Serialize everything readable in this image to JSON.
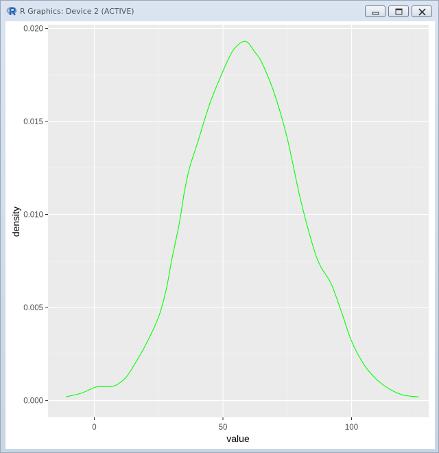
{
  "window": {
    "title": "R Graphics: Device 2 (ACTIVE)",
    "icon": "r-logo-icon",
    "buttons": [
      {
        "name": "minimize",
        "icon": "minimize-icon"
      },
      {
        "name": "maximize",
        "icon": "maximize-icon"
      },
      {
        "name": "close",
        "icon": "close-icon"
      }
    ]
  },
  "colors": {
    "panel_background": "#ebebeb",
    "grid_major": "#ffffff",
    "grid_minor": "#f5f5f5",
    "line": "#00ff00",
    "axis_text": "#4d4d4d"
  },
  "chart_data": {
    "type": "line",
    "geom": "density",
    "xlabel": "value",
    "ylabel": "density",
    "xlim": [
      -18,
      130
    ],
    "ylim": [
      -0.0009,
      0.0202
    ],
    "x_ticks": [
      0,
      50,
      100
    ],
    "x_tick_labels": [
      "0",
      "50",
      "100"
    ],
    "y_ticks": [
      0,
      0.005,
      0.01,
      0.015,
      0.02
    ],
    "y_tick_labels": [
      "0.000",
      "0.005",
      "0.010",
      "0.015",
      "0.020"
    ],
    "grid": true,
    "legend": "none",
    "series": [
      {
        "color": "#00ff00",
        "x": [
          -11,
          -5,
          0,
          2,
          5,
          8,
          12,
          15,
          20,
          25,
          28,
          30,
          33,
          35,
          37,
          40,
          45,
          50,
          53,
          55,
          58,
          60,
          62,
          65,
          70,
          75,
          80,
          85,
          88,
          92,
          96,
          100,
          105,
          110,
          115,
          120,
          126
        ],
        "y": [
          0.0002,
          0.0004,
          0.0007,
          0.00075,
          0.00075,
          0.0008,
          0.0012,
          0.0018,
          0.003,
          0.0045,
          0.006,
          0.0075,
          0.0095,
          0.0112,
          0.0125,
          0.0138,
          0.016,
          0.0177,
          0.0186,
          0.019,
          0.0193,
          0.0192,
          0.0188,
          0.0182,
          0.0165,
          0.0141,
          0.0109,
          0.0083,
          0.0072,
          0.0063,
          0.0048,
          0.0032,
          0.0019,
          0.0011,
          0.0006,
          0.0003,
          0.0002
        ]
      }
    ]
  }
}
